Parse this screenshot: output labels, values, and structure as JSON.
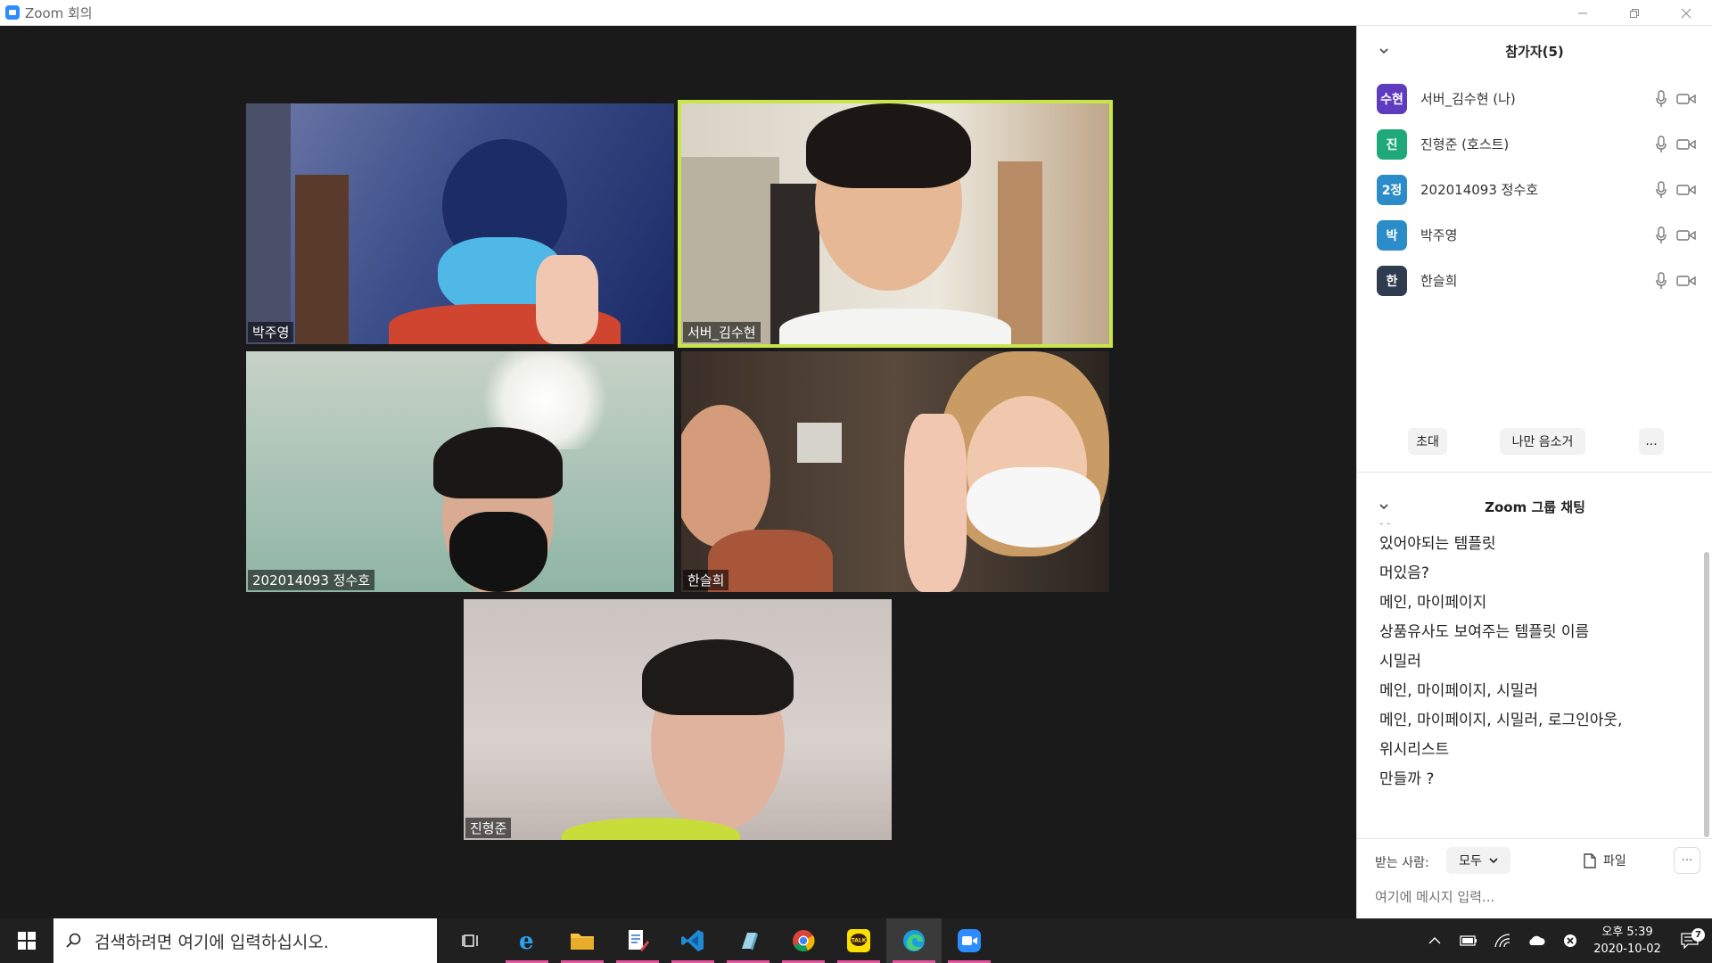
{
  "window": {
    "title": "Zoom 회의"
  },
  "video_tiles": [
    {
      "name": "박주영"
    },
    {
      "name": "서버_김수현"
    },
    {
      "name": "202014093 정수호"
    },
    {
      "name": "한슬희"
    },
    {
      "name": "진형준"
    }
  ],
  "participants": {
    "header": "참가자(5)",
    "list": [
      {
        "avatar": "수현",
        "name": "서버_김수현 (나)",
        "color": "#5e3bbf"
      },
      {
        "avatar": "진",
        "name": "진형준 (호스트)",
        "color": "#1fa87a"
      },
      {
        "avatar": "2정",
        "name": "202014093 정수호",
        "color": "#2c8cc9"
      },
      {
        "avatar": "박",
        "name": "박주영",
        "color": "#2c8cc9"
      },
      {
        "avatar": "한",
        "name": "한슬희",
        "color": "#2f3b4f"
      }
    ],
    "invite_label": "초대",
    "mute_self_label": "나만 음소거",
    "more_label": "..."
  },
  "chat": {
    "header": "Zoom 그룹 채팅",
    "messages": [
      "있어야되는 템플릿",
      "머있음?",
      "메인, 마이페이지",
      "상품유사도 보여주는 템플릿 이름",
      "시밀러",
      "메인, 마이페이지, 시밀러",
      "메인, 마이페이지, 시밀러, 로그인아웃,",
      "위시리스트",
      "만들까 ?"
    ],
    "recipient_label": "받는 사람:",
    "recipient_value": "모두",
    "file_label": "파일",
    "more_label": "···",
    "input_placeholder": "여기에 메시지 입력..."
  },
  "taskbar": {
    "search_placeholder": "검색하려면 여기에 입력하십시오.",
    "time": "오후 5:39",
    "date": "2020-10-02",
    "notification_count": "7"
  }
}
